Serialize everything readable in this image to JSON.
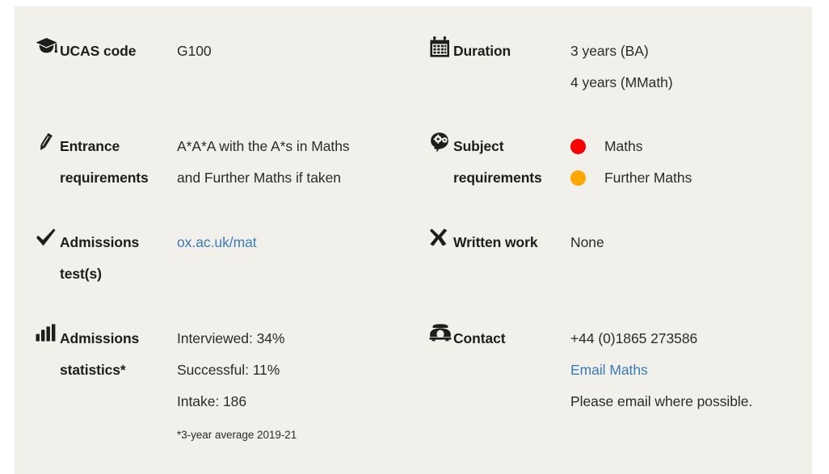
{
  "theme": {
    "page_background": "#ffffff",
    "panel_background": "#f1f0ea",
    "text_color": "#2b2b29",
    "label_color": "#1d1d1b",
    "link_color": "#3b7cb5"
  },
  "rows": [
    {
      "id": "ucas-code",
      "icon": "graduation-cap-icon",
      "label": "UCAS code",
      "values": [
        "G100"
      ]
    },
    {
      "id": "duration",
      "icon": "calendar-icon",
      "label": "Duration",
      "values": [
        "3 years (BA)",
        "4 years (MMath)"
      ]
    },
    {
      "id": "entrance-requirements",
      "icon": "pencil-icon",
      "label": "Entrance requirements",
      "label_line_1": "Entrance",
      "label_line_2": "requirements",
      "values": [
        "A*A*A with the A*s in Maths",
        "and Further Maths if taken"
      ]
    },
    {
      "id": "subject-requirements",
      "icon": "head-gears-icon",
      "label": "Subject requirements",
      "label_line_1": "Subject",
      "label_line_2": "requirements",
      "subjects": [
        {
          "name": "Maths",
          "color": "#fa0000"
        },
        {
          "name": "Further Maths",
          "color": "#fca600"
        }
      ]
    },
    {
      "id": "admissions-test",
      "icon": "check-icon",
      "label": "Admissions test(s)",
      "label_line_1": "Admissions",
      "label_line_2": "test(s)",
      "link_text": "ox.ac.uk/mat"
    },
    {
      "id": "written-work",
      "icon": "cross-icon",
      "label": "Written work",
      "values": [
        "None"
      ]
    },
    {
      "id": "admissions-statistics",
      "icon": "bar-chart-icon",
      "label": "Admissions statistics*",
      "label_line_1": "Admissions",
      "label_line_2": "statistics*",
      "values": [
        "Interviewed: 34%",
        "Successful: 11%",
        "Intake: 186"
      ],
      "footnote": "*3-year average 2019-21"
    },
    {
      "id": "contact",
      "icon": "telephone-icon",
      "label": "Contact",
      "values": [
        "+44 (0)1865 273586"
      ],
      "link_text": "Email Maths",
      "note": "Please email where possible."
    }
  ]
}
